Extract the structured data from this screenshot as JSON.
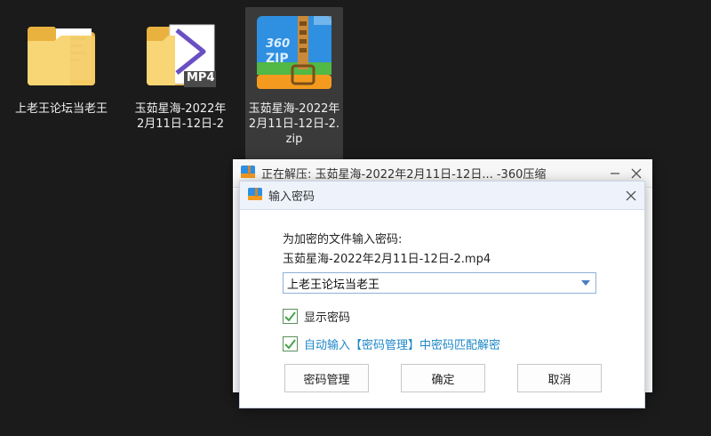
{
  "desktop": {
    "icons": [
      {
        "name": "上老王论坛当老王",
        "type": "folder"
      },
      {
        "name": "玉茹星海-2022年2月11日-12日-2",
        "type": "folder-mp4",
        "badge": "MP4"
      },
      {
        "name": "玉茹星海-2022年2月11日-12日-2.zip",
        "type": "zip",
        "badge_top": "360",
        "badge_bottom": "ZIP"
      }
    ]
  },
  "progress_window": {
    "title": "正在解压: 玉茹星海-2022年2月11日-12日... -360压缩"
  },
  "dialog": {
    "title": "输入密码",
    "prompt": "为加密的文件输入密码:",
    "filename": "玉茹星海-2022年2月11日-12日-2.mp4",
    "password_value": "上老王论坛当老王",
    "show_password_label": "显示密码",
    "auto_input_label": "自动输入【密码管理】中密码匹配解密",
    "buttons": {
      "manage": "密码管理",
      "ok": "确定",
      "cancel": "取消"
    }
  },
  "colors": {
    "desktop_bg": "#1b1b1b",
    "folder_yellow": "#f4c75a",
    "zip_blue": "#2f8fe0",
    "zip_green": "#52b846",
    "zip_orange": "#f49b1f",
    "link_blue": "#1e88c8",
    "check_green": "#4aa14a"
  }
}
